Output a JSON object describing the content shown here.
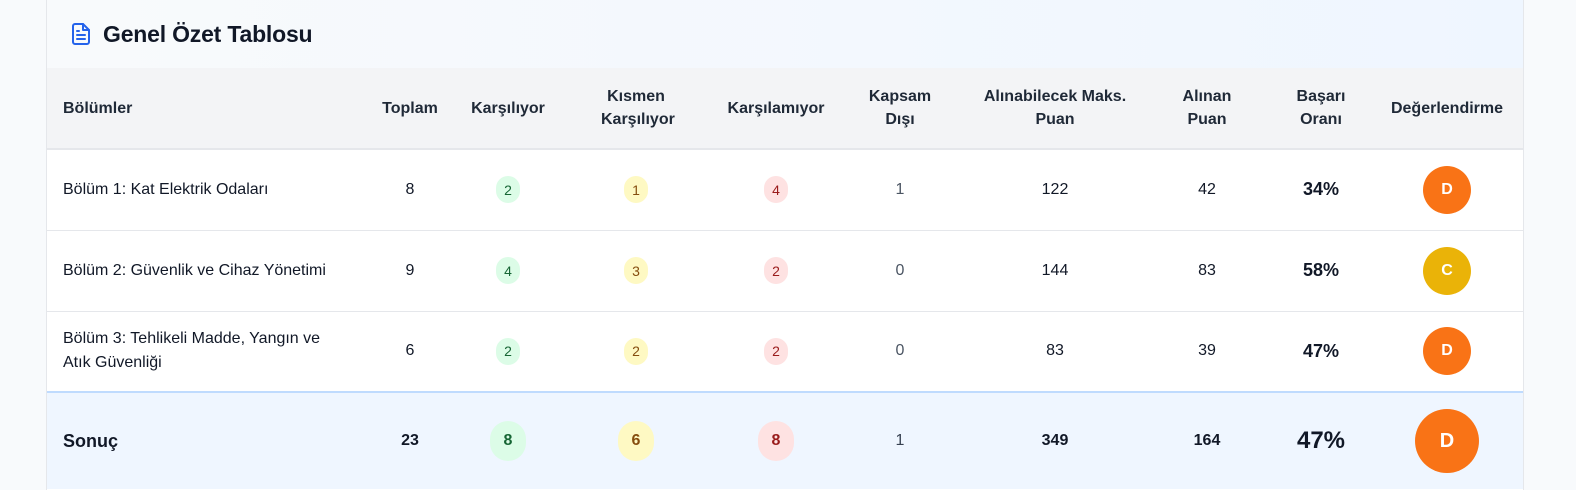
{
  "header": {
    "title": "Genel Özet Tablosu",
    "icon": "document-icon",
    "accent": "#2563eb"
  },
  "columns": [
    "Bölümler",
    "Toplam",
    "Karşılıyor",
    "Kısmen Karşılıyor",
    "Karşılamıyor",
    "Kapsam Dışı",
    "Alınabilecek Maks. Puan",
    "Alınan Puan",
    "Başarı Oranı",
    "Değerlendirme"
  ],
  "rows": [
    {
      "section": "Bölüm 1: Kat Elektrik Odaları",
      "total": "8",
      "meets": "2",
      "partial": "1",
      "not_meets": "4",
      "out_of_scope": "1",
      "max_points": "122",
      "points": "42",
      "rate": "34%",
      "grade": "D",
      "grade_color": "#f97316"
    },
    {
      "section": "Bölüm 2: Güvenlik ve Cihaz Yönetimi",
      "total": "9",
      "meets": "4",
      "partial": "3",
      "not_meets": "2",
      "out_of_scope": "0",
      "max_points": "144",
      "points": "83",
      "rate": "58%",
      "grade": "C",
      "grade_color": "#eab308"
    },
    {
      "section": "Bölüm 3: Tehlikeli Madde, Yangın ve Atık Güvenliği",
      "total": "6",
      "meets": "2",
      "partial": "2",
      "not_meets": "2",
      "out_of_scope": "0",
      "max_points": "83",
      "points": "39",
      "rate": "47%",
      "grade": "D",
      "grade_color": "#f97316"
    }
  ],
  "summary": {
    "label": "Sonuç",
    "total": "23",
    "meets": "8",
    "partial": "6",
    "not_meets": "8",
    "out_of_scope": "1",
    "max_points": "349",
    "points": "164",
    "rate": "47%",
    "grade": "D",
    "grade_color": "#f97316"
  }
}
